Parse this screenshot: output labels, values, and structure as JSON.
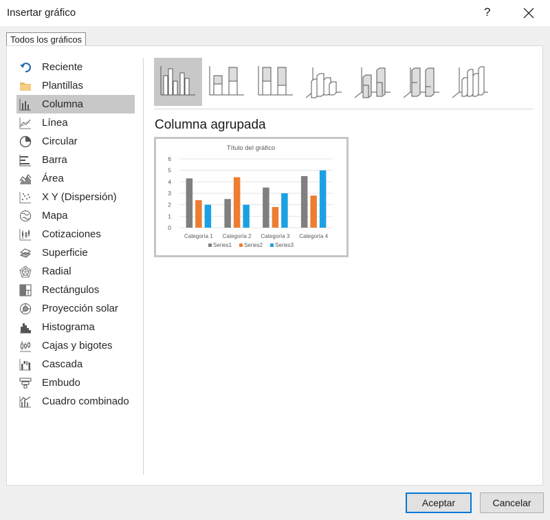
{
  "window": {
    "title": "Insertar gráfico",
    "help": "?"
  },
  "tab": {
    "label": "Todos los gráficos"
  },
  "categories": [
    {
      "label": "Reciente",
      "icon": "recent-icon"
    },
    {
      "label": "Plantillas",
      "icon": "folder-icon"
    },
    {
      "label": "Columna",
      "icon": "column-chart-icon"
    },
    {
      "label": "Línea",
      "icon": "line-chart-icon"
    },
    {
      "label": "Circular",
      "icon": "pie-chart-icon"
    },
    {
      "label": "Barra",
      "icon": "bar-chart-icon"
    },
    {
      "label": "Área",
      "icon": "area-chart-icon"
    },
    {
      "label": "X Y (Dispersión)",
      "icon": "scatter-chart-icon"
    },
    {
      "label": "Mapa",
      "icon": "map-chart-icon"
    },
    {
      "label": "Cotizaciones",
      "icon": "stock-chart-icon"
    },
    {
      "label": "Superficie",
      "icon": "surface-chart-icon"
    },
    {
      "label": "Radial",
      "icon": "radar-chart-icon"
    },
    {
      "label": "Rectángulos",
      "icon": "treemap-chart-icon"
    },
    {
      "label": "Proyección solar",
      "icon": "sunburst-chart-icon"
    },
    {
      "label": "Histograma",
      "icon": "histogram-chart-icon"
    },
    {
      "label": "Cajas y bigotes",
      "icon": "box-whisker-chart-icon"
    },
    {
      "label": "Cascada",
      "icon": "waterfall-chart-icon"
    },
    {
      "label": "Embudo",
      "icon": "funnel-chart-icon"
    },
    {
      "label": "Cuadro combinado",
      "icon": "combo-chart-icon"
    }
  ],
  "selected_category": "Columna",
  "subtypes": [
    {
      "icon": "clustered-column-icon",
      "selected": true
    },
    {
      "icon": "stacked-column-icon",
      "selected": false
    },
    {
      "icon": "100-stacked-column-icon",
      "selected": false
    },
    {
      "icon": "3d-clustered-column-icon",
      "selected": false
    },
    {
      "icon": "3d-stacked-column-icon",
      "selected": false
    },
    {
      "icon": "3d-100-stacked-column-icon",
      "selected": false
    },
    {
      "icon": "3d-column-icon",
      "selected": false
    }
  ],
  "subtype_name": "Columna agrupada",
  "chart_data": {
    "type": "bar",
    "title": "Título del gráfico",
    "categories": [
      "Categoría 1",
      "Categoría 2",
      "Categoría 3",
      "Categoría 4"
    ],
    "series": [
      {
        "name": "Series1",
        "values": [
          4.3,
          2.5,
          3.5,
          4.5
        ],
        "color": "#7f7f7f"
      },
      {
        "name": "Series2",
        "values": [
          2.4,
          4.4,
          1.8,
          2.8
        ],
        "color": "#ed7d31"
      },
      {
        "name": "Series3",
        "values": [
          2,
          2,
          3,
          5
        ],
        "color": "#1ba1e2"
      }
    ],
    "ylim": [
      0,
      6
    ],
    "yticks": [
      "0",
      "1",
      "2",
      "3",
      "4",
      "5",
      "6"
    ],
    "grid": true,
    "legend": "bottom"
  },
  "buttons": {
    "ok": "Aceptar",
    "cancel": "Cancelar"
  }
}
